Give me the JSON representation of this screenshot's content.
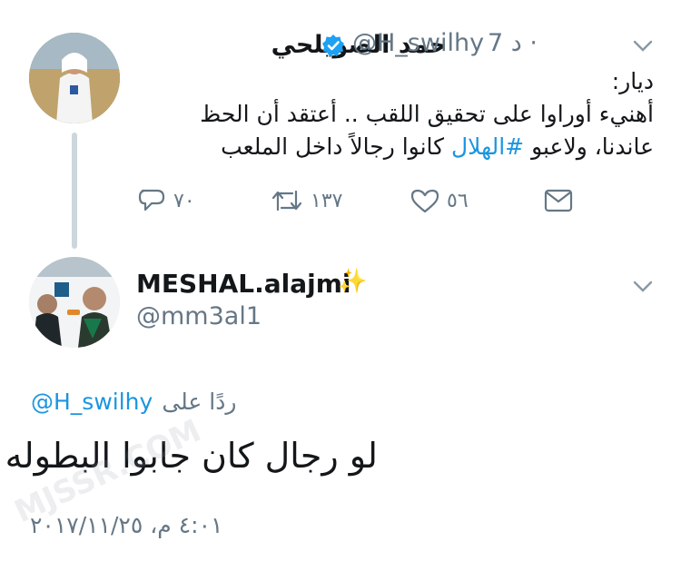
{
  "tweet": {
    "display_name": "حمد الصويلحي",
    "handle": "@H_swilhy",
    "time": "7 د ·",
    "text_lines": [
      "ديار:",
      "أهنيء أوراوا على تحقيق اللقب .. أعتقد أن الحظ",
      "عاندنا، ولاعبو "
    ],
    "hashtag": "#الهلال",
    "text_tail": " كانوا رجالاً داخل الملعب",
    "actions": {
      "reply_count": "٧٠",
      "retweet_count": "١٣٧",
      "like_count": "٥٦"
    }
  },
  "reply": {
    "display_name": "MESHAL.alajmi",
    "name_emoji": "✨",
    "handle": "@mm3al1",
    "replying_label": "ردًا على",
    "replying_to": "@H_swilhy",
    "text": "لو رجال كان جابوا البطوله",
    "timestamp": "٤:٠١ م، ٢٠١٧/١١/٢٥"
  },
  "icons": [
    "chevron-down-icon",
    "verified-badge-icon",
    "reply-icon",
    "retweet-icon",
    "like-icon",
    "message-icon"
  ],
  "colors": {
    "link": "#1b95e0",
    "secondary_text": "#657786",
    "primary_text": "#14171a",
    "verified": "#1da1f2"
  },
  "watermark": "MJSSR.COM"
}
